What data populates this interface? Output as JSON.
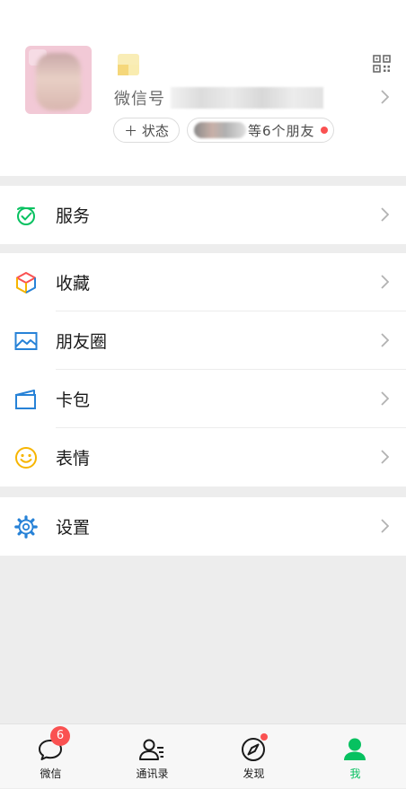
{
  "profile": {
    "wechat_id_label": "微信号",
    "status_button": "＋ 状态",
    "friends_text": "等6个朋友"
  },
  "menu": {
    "services": "服务",
    "favorites": "收藏",
    "moments": "朋友圈",
    "cards": "卡包",
    "stickers": "表情",
    "settings": "设置"
  },
  "tabbar": {
    "chats": "微信",
    "chats_badge": "6",
    "contacts": "通讯录",
    "discover": "发现",
    "me": "我"
  },
  "colors": {
    "brand_green": "#07c160",
    "badge_red": "#fa5151",
    "page_gray": "#ededed"
  },
  "icons": [
    "avatar",
    "qr-code-icon",
    "chevron-right-icon",
    "services-icon",
    "favorites-icon",
    "moments-icon",
    "card-wallet-icon",
    "sticker-icon",
    "settings-icon",
    "chats-icon",
    "contacts-icon",
    "discover-icon",
    "me-icon"
  ]
}
